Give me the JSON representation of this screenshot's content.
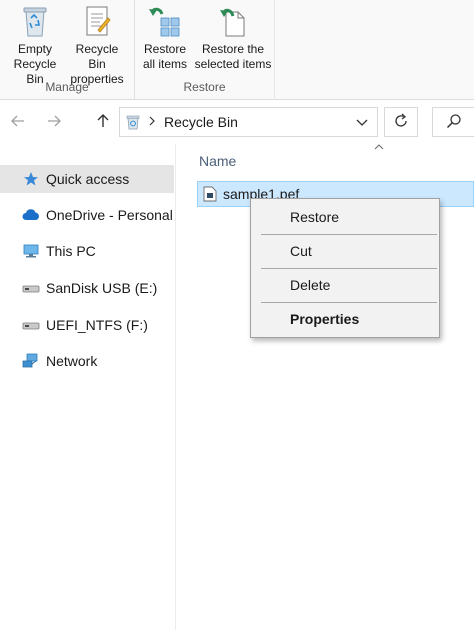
{
  "ribbon": {
    "manage": {
      "group_label": "Manage",
      "empty_bin": {
        "line1": "Empty",
        "line2": "Recycle Bin"
      },
      "bin_properties": {
        "line1": "Recycle Bin",
        "line2": "properties"
      }
    },
    "restore": {
      "group_label": "Restore",
      "restore_all": {
        "line1": "Restore",
        "line2": "all items"
      },
      "restore_selected": {
        "line1": "Restore the",
        "line2": "selected items"
      }
    }
  },
  "address": {
    "path": "Recycle Bin",
    "icons": {
      "back": "back-arrow-icon",
      "forward": "forward-arrow-icon",
      "up": "up-arrow-icon",
      "location": "recycle-bin-small-icon",
      "dropdown": "chevron-down-icon",
      "refresh": "refresh-icon",
      "search": "search-icon"
    }
  },
  "navpane": {
    "items": [
      {
        "label": "Quick access",
        "icon": "star-icon",
        "selected": true
      },
      {
        "label": "OneDrive - Personal",
        "icon": "cloud-icon"
      },
      {
        "label": "This PC",
        "icon": "computer-icon"
      },
      {
        "label": "SanDisk USB (E:)",
        "icon": "usb-drive-icon"
      },
      {
        "label": "UEFI_NTFS (F:)",
        "icon": "drive-icon"
      },
      {
        "label": "Network",
        "icon": "network-icon"
      }
    ]
  },
  "content": {
    "column_name": "Name",
    "file": {
      "name": "sample1.pef",
      "icon": "file-icon"
    }
  },
  "context_menu": {
    "items": [
      {
        "label": "Restore"
      },
      {
        "label": "Cut"
      },
      {
        "label": "Delete"
      },
      {
        "label": "Properties",
        "bold": true
      }
    ]
  },
  "colors": {
    "selection": "#cce8ff",
    "selection_border": "#99d1ff",
    "accent": "#0078d7",
    "restore_green": "#2e8b57"
  }
}
